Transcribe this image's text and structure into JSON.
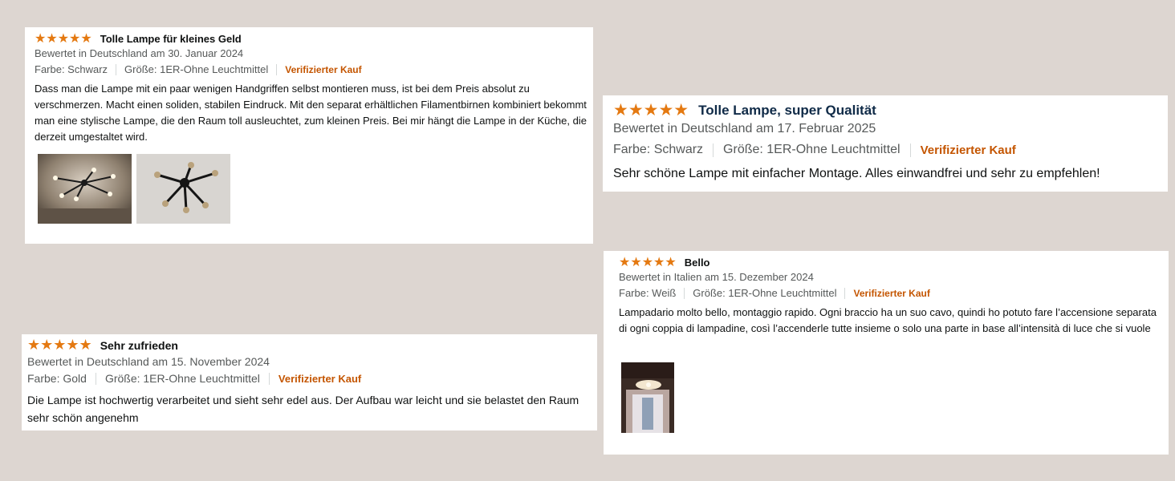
{
  "rating_icon": "five-star-rating-icon",
  "accent_colors": {
    "stars": "#e47911",
    "verified": "#c45500",
    "background": "#ddd6d1"
  },
  "reviews": [
    {
      "stars": "★★★★★",
      "title": "Tolle Lampe für kleines Geld",
      "meta": "Bewertet in Deutschland am 30. Januar 2024",
      "color": "Farbe: Schwarz",
      "size": "Größe: 1ER-Ohne Leuchtmittel",
      "verified": "Verifizierter Kauf",
      "text": "Dass man die Lampe mit ein paar wenigen Handgriffen selbst montieren muss, ist bei dem Preis absolut zu verschmerzen. Macht einen soliden, stabilen Eindruck. Mit den separat erhältlichen Filamentbirnen kombiniert bekommt man eine stylische Lampe, die den Raum toll ausleuchtet, zum kleinen Preis. Bei mir hängt die Lampe in der Küche, die derzeit umgestaltet wird.",
      "photos": [
        "ceiling-lamp-photo",
        "ceiling-lamp-photo"
      ]
    },
    {
      "stars": "★★★★★",
      "title": "Tolle Lampe, super Qualität",
      "meta": "Bewertet in Deutschland am 17. Februar 2025",
      "color": "Farbe: Schwarz",
      "size": "Größe: 1ER-Ohne Leuchtmittel",
      "verified": "Verifizierter Kauf",
      "text": "Sehr schöne Lampe mit einfacher Montage. Alles einwandfrei und sehr zu empfehlen!"
    },
    {
      "stars": "★★★★★",
      "title": "Sehr zufrieden",
      "meta": "Bewertet in Deutschland am 15. November 2024",
      "color": "Farbe: Gold",
      "size": "Größe: 1ER-Ohne Leuchtmittel",
      "verified": "Verifizierter Kauf",
      "text": "Die Lampe ist hochwertig verarbeitet und sieht sehr edel aus. Der Aufbau war leicht und sie belastet den Raum sehr schön angenehm"
    },
    {
      "stars": "★★★★★",
      "title": "Bello",
      "meta": "Bewertet in Italien am 15. Dezember 2024",
      "color": "Farbe: Weiß",
      "size": "Größe: 1ER-Ohne Leuchtmittel",
      "verified": "Verifizierter Kauf",
      "text": "Lampadario molto bello, montaggio rapido. Ogni braccio ha un suo cavo, quindi ho potuto fare l’accensione separata di ogni coppia di lampadine, così l’accenderle tutte insieme o solo una parte in base all’intensità di luce che si vuole",
      "photos": [
        "room-lamp-photo"
      ]
    }
  ]
}
